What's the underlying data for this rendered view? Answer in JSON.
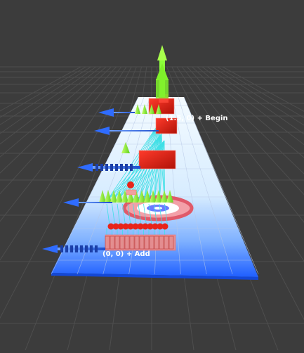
{
  "scene": {
    "background_color": "#3c3c3c",
    "grid_color": "#555555",
    "lane_color_far": "#cfe6ff",
    "lane_color_near": "#1f6bff",
    "axis_up_color": "#8cff3a",
    "axis_side_color": "#2f6cff",
    "marker_color": "#e8241a",
    "link_line_color": "#3fe0e6",
    "target_ring_color": "#e05a6a",
    "target_center_color": "#6a7cff"
  },
  "labels": {
    "far_label": "(1.5, 0) + Begin",
    "near_label": "(0, 0) + Add"
  },
  "icons": {
    "up_arrow": "green-arrow-up-icon",
    "side_arrow": "blue-arrow-left-icon",
    "cone": "green-cone-icon",
    "box": "red-box-icon",
    "sphere": "red-sphere-icon",
    "target": "bullseye-target-icon"
  }
}
